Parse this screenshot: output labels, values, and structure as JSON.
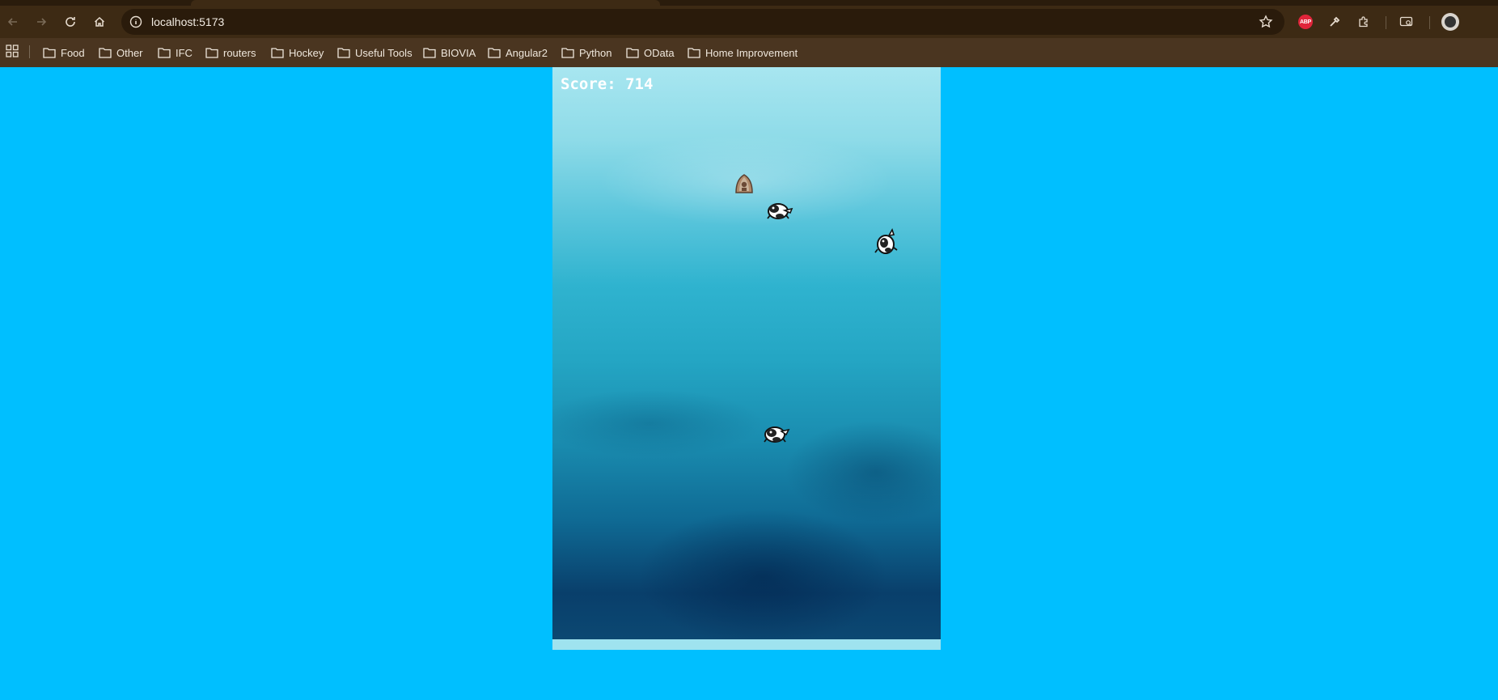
{
  "browser": {
    "url": "localhost:5173",
    "bookmarks": [
      {
        "label": "Food"
      },
      {
        "label": "Other"
      },
      {
        "label": "IFC"
      },
      {
        "label": "routers"
      },
      {
        "label": "Hockey"
      },
      {
        "label": "Useful Tools"
      },
      {
        "label": "BIOVIA"
      },
      {
        "label": "Angular2"
      },
      {
        "label": "Python"
      },
      {
        "label": "OData"
      },
      {
        "label": "Home Improvement"
      }
    ],
    "extensions": {
      "adblock_label": "ABP"
    }
  },
  "game": {
    "score_text": "Score: 714",
    "player": {
      "icon": "boat-icon"
    },
    "enemies": [
      {
        "icon": "penguin-icon"
      },
      {
        "icon": "penguin-icon"
      },
      {
        "icon": "penguin-icon"
      }
    ]
  },
  "colors": {
    "page_background": "#00bfff",
    "chrome": "#3d2a14",
    "bookmarks_bar": "#4a3520"
  }
}
